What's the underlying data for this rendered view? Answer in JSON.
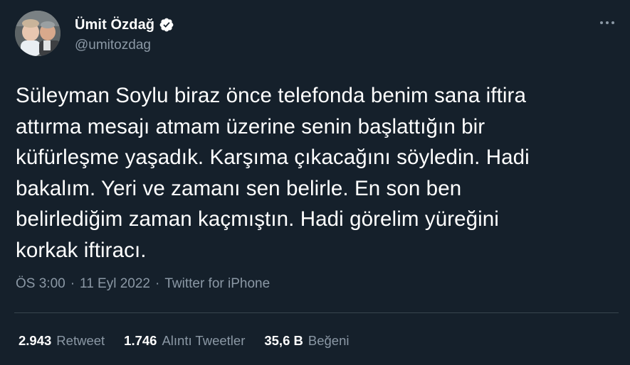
{
  "author": {
    "display_name": "Ümit Özdağ",
    "handle": "@umitozdag",
    "verified": true
  },
  "tweet": {
    "text": "Süleyman Soylu biraz önce telefonda benim sana iftira\nattırma mesajı atmam üzerine senin başlattığın bir\nküfürleşme yaşadık. Karşıma çıkacağını söyledin. Hadi\nbakalım. Yeri ve zamanı sen belirle. En son ben\nbelirlediğim zaman kaçmıştın. Hadi görelim yüreğini\nkorkak iftiracı.",
    "time": "ÖS 3:00",
    "separator": "·",
    "date": "11 Eyl 2022",
    "source": "Twitter for iPhone"
  },
  "stats": [
    {
      "value": "2.943",
      "label": "Retweet"
    },
    {
      "value": "1.746",
      "label": "Alıntı Tweetler"
    },
    {
      "value": "35,6 B",
      "label": "Beğeni"
    }
  ],
  "icons": {
    "verified": "verified-badge-icon",
    "more": "more-horizontal-icon"
  },
  "colors": {
    "background": "#15202b",
    "text_primary": "#ffffff",
    "text_secondary": "#8b98a5",
    "divider": "#38444d"
  }
}
